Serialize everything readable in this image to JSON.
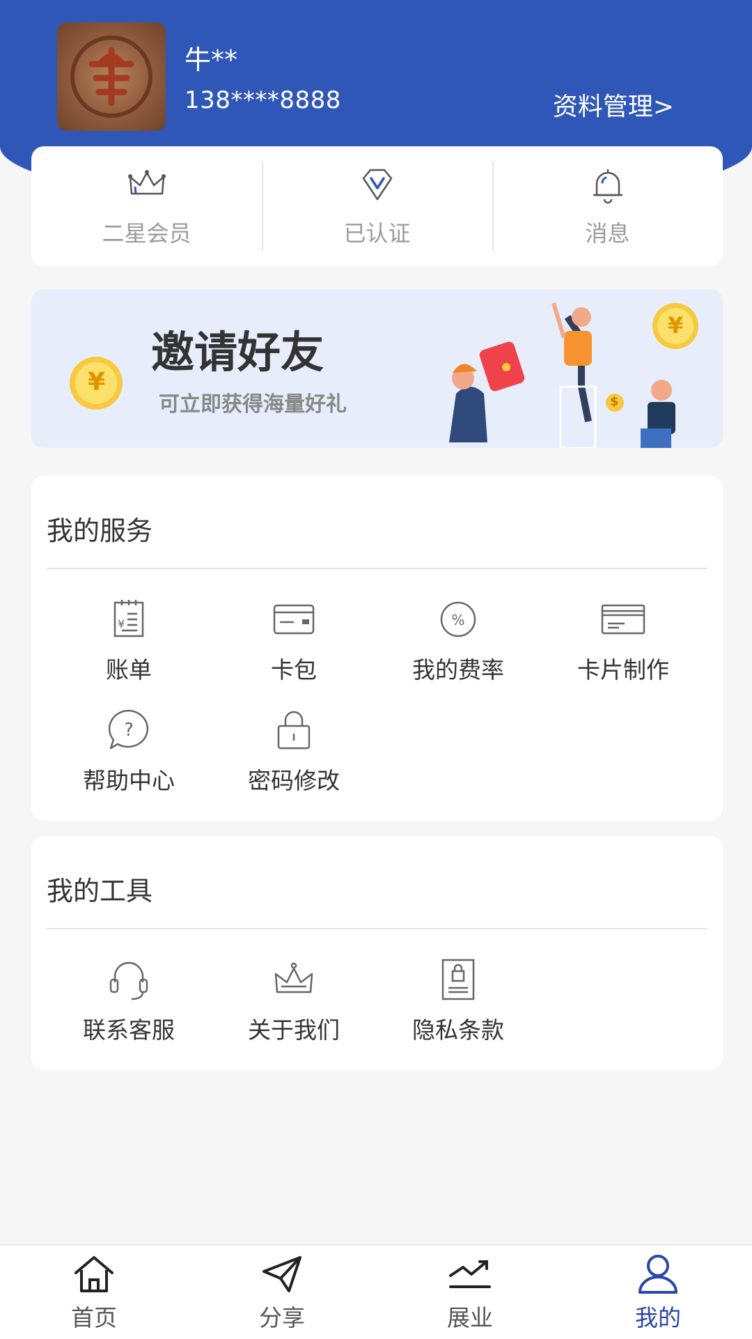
{
  "header": {
    "user_name": "牛**",
    "phone": "138****8888",
    "profile_link": "资料管理>",
    "accent_color": "#2f57b8"
  },
  "status": [
    {
      "label": "二星会员",
      "icon": "crown-icon"
    },
    {
      "label": "已认证",
      "icon": "diamond-icon"
    },
    {
      "label": "消息",
      "icon": "bell-icon"
    }
  ],
  "banner": {
    "title": "邀请好友",
    "subtitle": "可立即获得海量好礼",
    "coin_symbol": "¥",
    "dollar_symbol": "$"
  },
  "services": {
    "title": "我的服务",
    "items": [
      {
        "label": "账单",
        "icon": "bill-icon"
      },
      {
        "label": "卡包",
        "icon": "card-wallet-icon"
      },
      {
        "label": "我的费率",
        "icon": "percent-icon",
        "glyph": "%"
      },
      {
        "label": "卡片制作",
        "icon": "card-icon"
      },
      {
        "label": "帮助中心",
        "icon": "help-icon",
        "glyph": "?"
      },
      {
        "label": "密码修改",
        "icon": "lock-icon"
      }
    ]
  },
  "tools": {
    "title": "我的工具",
    "items": [
      {
        "label": "联系客服",
        "icon": "headset-icon"
      },
      {
        "label": "关于我们",
        "icon": "crown-icon"
      },
      {
        "label": "隐私条款",
        "icon": "privacy-doc-icon"
      }
    ]
  },
  "tabbar": {
    "items": [
      {
        "label": "首页",
        "icon": "home-icon"
      },
      {
        "label": "分享",
        "icon": "paper-plane-icon"
      },
      {
        "label": "展业",
        "icon": "trend-icon"
      },
      {
        "label": "我的",
        "icon": "user-icon",
        "active": true
      }
    ],
    "active_color": "#2a46a8"
  }
}
